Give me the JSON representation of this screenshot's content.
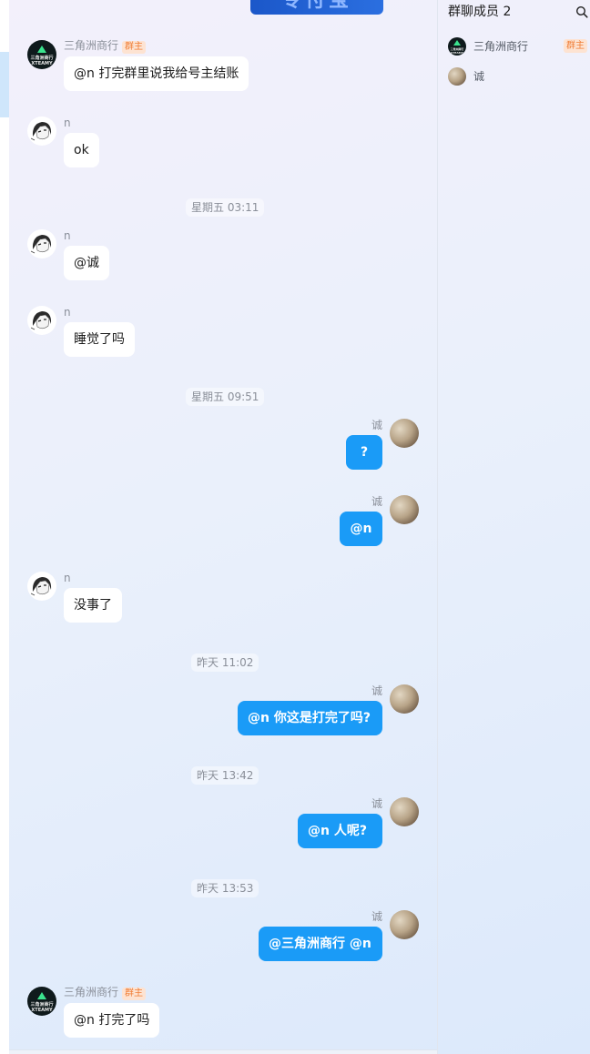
{
  "banner": {
    "text": "专付宝"
  },
  "members_panel": {
    "title": "群聊成员 2",
    "search_icon": "search-icon",
    "members": [
      {
        "name": "三角洲商行",
        "badge": "群主",
        "avatar": "team-logo-avatar"
      },
      {
        "name": "诚",
        "avatar": "stones-avatar"
      }
    ]
  },
  "avatar_logo": {
    "line1": "三角洲商行",
    "line2": "XTEAMY"
  },
  "messages": [
    {
      "sender": "三角洲商行",
      "badge": "群主",
      "text": "@n 打完群里说我给号主结账",
      "direction": "in"
    },
    {
      "sender": "n",
      "text": "ok",
      "direction": "in"
    },
    {
      "time": "星期五 03:11"
    },
    {
      "sender": "n",
      "text": "@诚",
      "direction": "in"
    },
    {
      "sender": "n",
      "text": "睡觉了吗",
      "direction": "in"
    },
    {
      "time": "星期五 09:51"
    },
    {
      "sender": "诚",
      "text": "?",
      "direction": "out"
    },
    {
      "sender": "诚",
      "text": "@n",
      "direction": "out"
    },
    {
      "sender": "n",
      "text": "没事了",
      "direction": "in"
    },
    {
      "time": "昨天 11:02"
    },
    {
      "sender": "诚",
      "text": "@n 你这是打完了吗?",
      "direction": "out"
    },
    {
      "time": "昨天 13:42"
    },
    {
      "sender": "诚",
      "text": "@n 人呢?",
      "direction": "out"
    },
    {
      "time": "昨天 13:53"
    },
    {
      "sender": "诚",
      "text": "@三角洲商行 @n",
      "direction": "out"
    },
    {
      "sender": "三角洲商行",
      "badge": "群主",
      "text": "@n 打完了吗",
      "direction": "in"
    }
  ],
  "colors": {
    "outgoing_bubble": "#1a9bf7",
    "incoming_bubble": "#ffffff",
    "owner_badge_text": "#f07d35",
    "owner_badge_bg": "#fde3d2"
  }
}
